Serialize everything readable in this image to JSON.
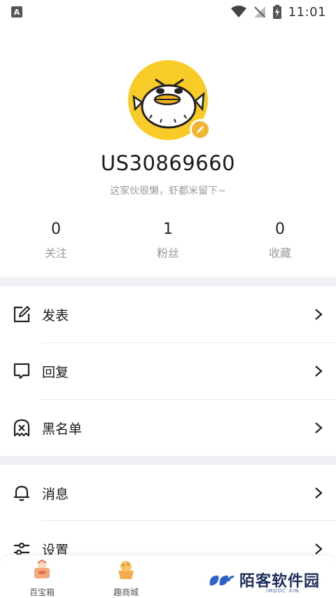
{
  "status_bar": {
    "indicator": "A",
    "time": "11:01",
    "icons": [
      "wifi-icon",
      "no-signal-icon",
      "battery-charging-icon"
    ]
  },
  "profile": {
    "username": "US30869660",
    "bio": "这家伙很懒，虾都米留下~",
    "stats": [
      {
        "value": "0",
        "label": "关注"
      },
      {
        "value": "1",
        "label": "粉丝"
      },
      {
        "value": "0",
        "label": "收藏"
      }
    ]
  },
  "menu": {
    "group1": [
      {
        "label": "发表",
        "icon": "edit-icon"
      },
      {
        "label": "回复",
        "icon": "reply-icon"
      },
      {
        "label": "黑名单",
        "icon": "blacklist-icon"
      }
    ],
    "group2": [
      {
        "label": "消息",
        "icon": "bell-icon"
      },
      {
        "label": "设置",
        "icon": "settings-icon"
      }
    ]
  },
  "tabbar": {
    "tabs": [
      {
        "label": "百宝箱",
        "icon": "treasure-icon"
      },
      {
        "label": "趣商城",
        "icon": "mall-icon"
      }
    ]
  },
  "watermark": {
    "text": "陌客软件园",
    "sub": "IMOOC XIN"
  },
  "colors": {
    "accent": "#f8cc28",
    "badge": "#f2b531",
    "separator": "#eff0f3"
  }
}
